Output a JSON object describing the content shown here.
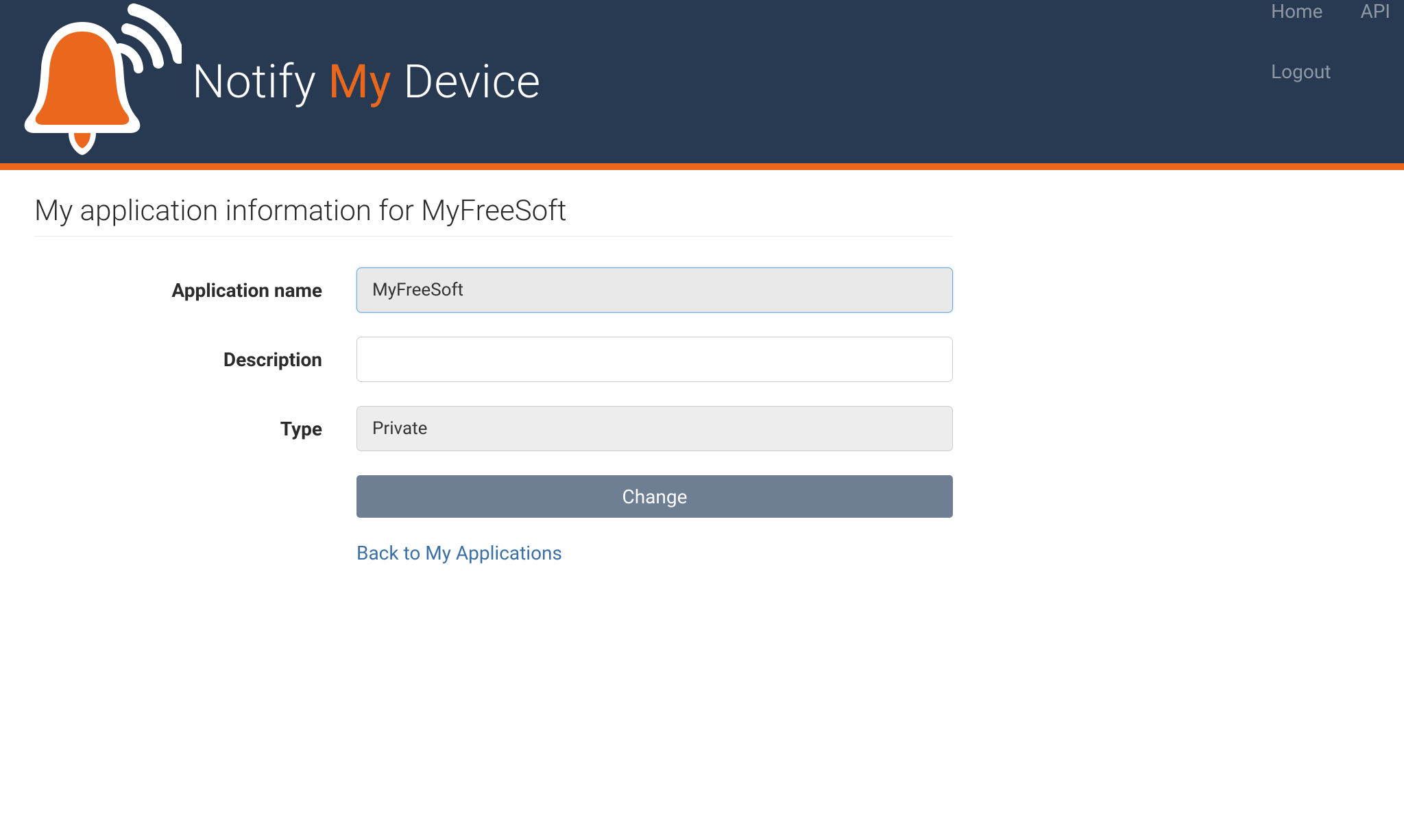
{
  "brand": {
    "word1": "Notify",
    "word2": "My",
    "word3": "Device"
  },
  "nav": {
    "home": "Home",
    "api": "API",
    "logout": "Logout"
  },
  "page": {
    "title": "My application information for MyFreeSoft"
  },
  "form": {
    "app_name_label": "Application name",
    "app_name_value": "MyFreeSoft",
    "description_label": "Description",
    "description_value": "",
    "type_label": "Type",
    "type_value": "Private",
    "change_button": "Change",
    "back_link": "Back to My Applications"
  },
  "colors": {
    "accent": "#e9681d",
    "header_bg": "#283a52",
    "button_bg": "#6e7e93",
    "link": "#3b6fa5"
  }
}
